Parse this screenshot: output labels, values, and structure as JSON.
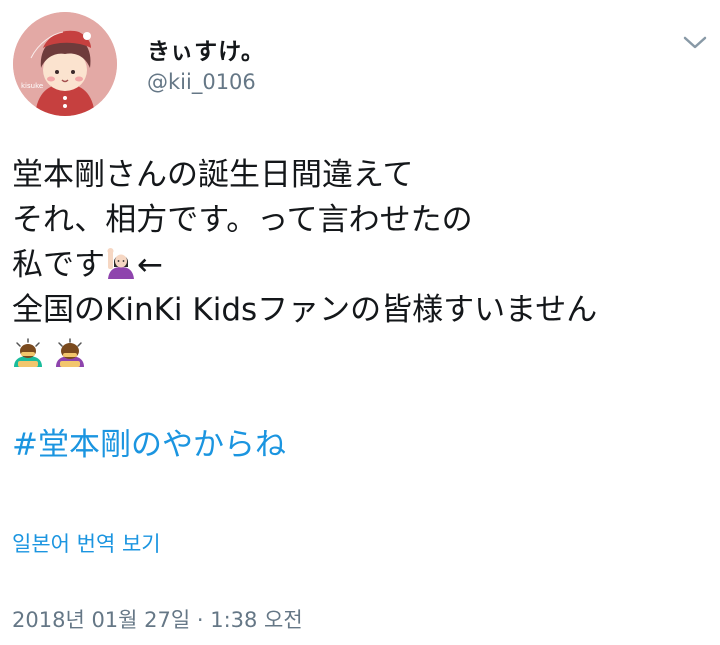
{
  "user": {
    "display_name": "きぃすけ。",
    "handle": "@kii_0106",
    "avatar_text": "kisuke"
  },
  "menu": {
    "icon": "chevron-down-icon"
  },
  "tweet": {
    "lines": [
      "堂本剛さんの誕生日間違えて",
      "それ、相方です。って言わせたの",
      "私です",
      "全国のKinKi Kidsファンの皆様すいません"
    ],
    "line3_suffix": "←",
    "emojis": {
      "raising_hand": "woman-raising-hand-emoji",
      "bowing_man": "man-bowing-emoji",
      "bowing_woman": "woman-bowing-emoji"
    },
    "hashtag": "#堂本剛のやからね"
  },
  "translate_label": "일본어 번역 보기",
  "timestamp": "2018년 01월 27일 · 1:38 오전",
  "colors": {
    "link": "#1b95e0",
    "secondary_text": "#657786",
    "primary_text": "#14171a",
    "avatar_bg": "#e3a9a5"
  }
}
